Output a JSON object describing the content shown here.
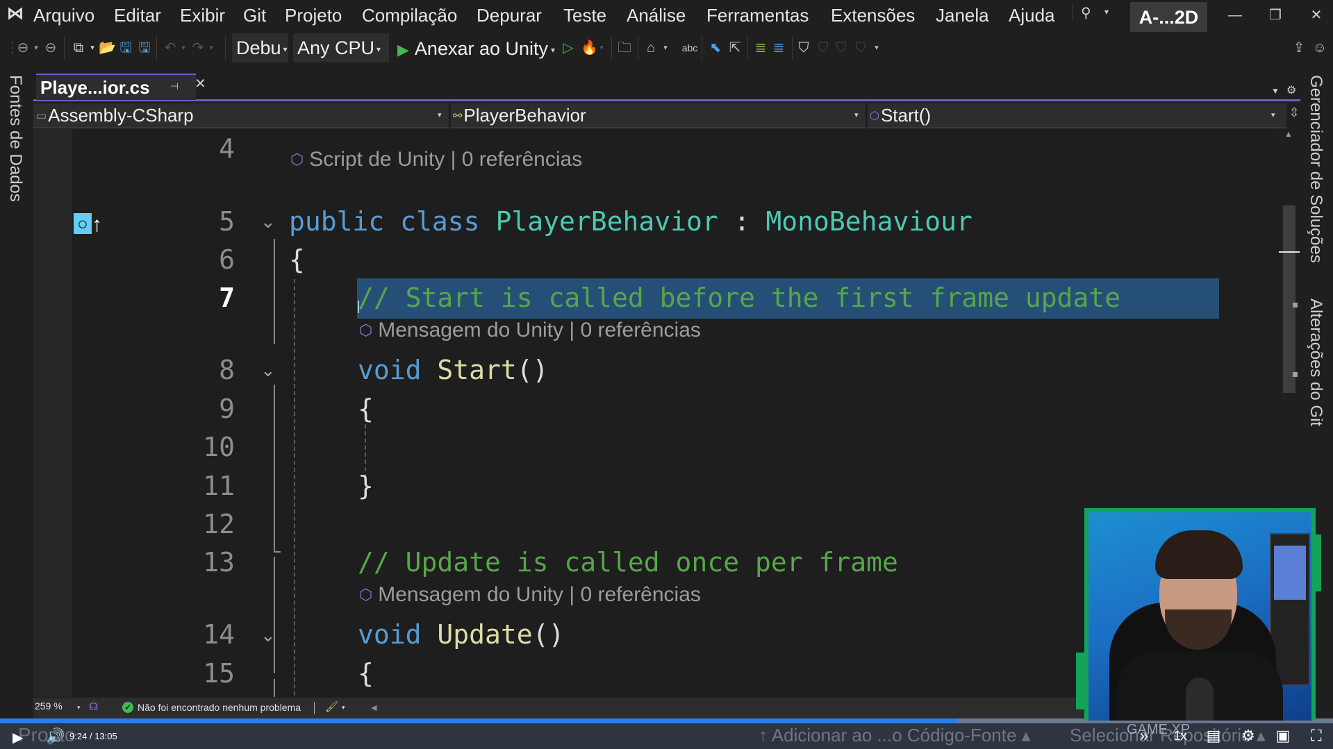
{
  "menubar": {
    "logo": "visual-studio-logo",
    "items": [
      "Arquivo",
      "Editar",
      "Exibir",
      "Git",
      "Projeto",
      "Compilação",
      "Depurar",
      "Teste",
      "Análise",
      "Ferramentas",
      "Extensões",
      "Janela",
      "Ajuda"
    ],
    "solution_name": "A-...2D",
    "window_buttons": {
      "minimize": "—",
      "restore": "❐",
      "close": "✕"
    }
  },
  "toolbar": {
    "configuration": "Debu",
    "platform": "Any CPU",
    "attach_label": "Anexar ao Unity"
  },
  "left_panel": {
    "tab_label": "Fontes de Dados"
  },
  "right_panel": {
    "tabs": [
      "Gerenciador de Soluções",
      "Alterações do Git"
    ]
  },
  "document_tab": {
    "label": "Playe...ior.cs"
  },
  "navbar": {
    "project": "Assembly-CSharp",
    "type": "PlayerBehavior",
    "member": "Start()"
  },
  "editor": {
    "current_line": 7,
    "lines": [
      {
        "num": "4"
      },
      {
        "lens": "Script de Unity | 0 referências"
      },
      {
        "num": "5",
        "code": [
          "public",
          "class",
          "PlayerBehavior",
          ":",
          "MonoBehaviour"
        ]
      },
      {
        "num": "6",
        "code": [
          "{"
        ]
      },
      {
        "num": "7",
        "code": [
          "// Start is called before the first frame update"
        ]
      },
      {
        "lens": "Mensagem do Unity | 0 referências"
      },
      {
        "num": "8",
        "code": [
          "void",
          "Start",
          "()"
        ]
      },
      {
        "num": "9",
        "code": [
          "{"
        ]
      },
      {
        "num": "10"
      },
      {
        "num": "11",
        "code": [
          "}"
        ]
      },
      {
        "num": "12"
      },
      {
        "num": "13",
        "code": [
          "// Update is called once per frame"
        ]
      },
      {
        "lens": "Mensagem do Unity | 0 referências"
      },
      {
        "num": "14",
        "code": [
          "void",
          "Update",
          "()"
        ]
      },
      {
        "num": "15",
        "code": [
          "{"
        ]
      }
    ]
  },
  "statusbar": {
    "zoom": "259 %",
    "issues": "Não foi encontrado nenhum problema"
  },
  "video_player": {
    "current_time": "9:24",
    "separator": "/",
    "duration": "13:05",
    "progress": 0.718,
    "speed": "1x",
    "ghost_ready": "Pronto",
    "ghost_add_source": "↑ Adicionar ao ...o Código-Fonte ▴",
    "ghost_select_repo": "Selecionar Repositório ▴",
    "watermark": "GAME XP"
  },
  "colors": {
    "accent": "#6c5fc7",
    "keyword": "#569cd6",
    "type": "#4ec9b0",
    "comment": "#57a64a",
    "method": "#dcdcaa",
    "selection": "#264f78",
    "progress": "#2b7de9",
    "webcam_frame": "#14a35a"
  }
}
